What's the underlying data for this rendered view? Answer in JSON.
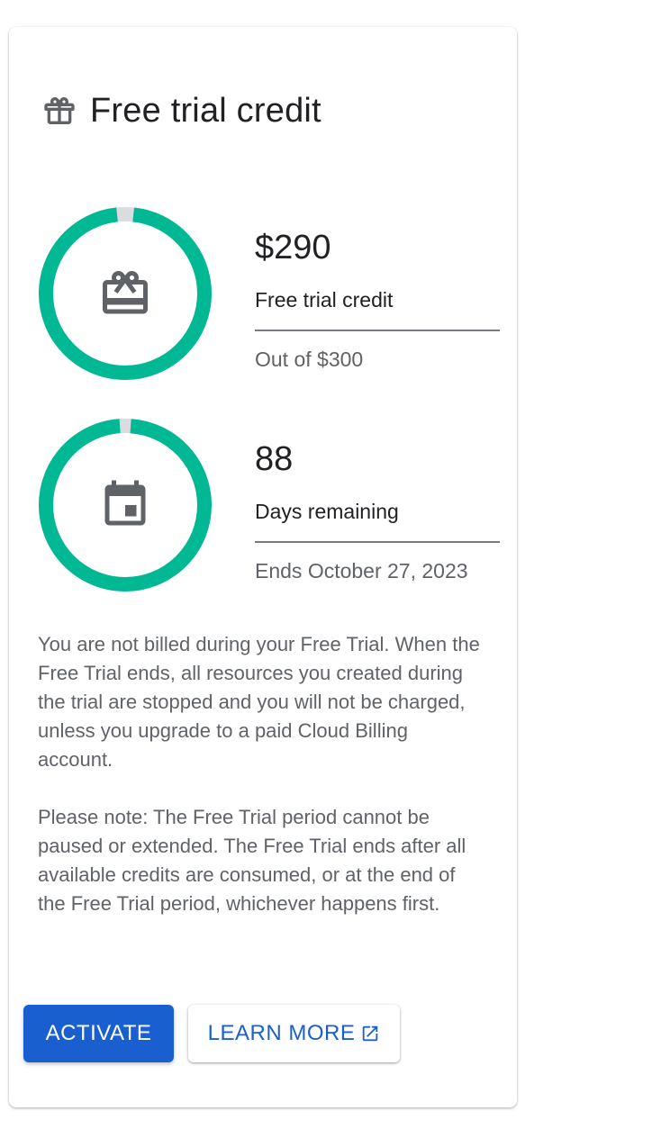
{
  "card": {
    "title": "Free trial credit",
    "title_icon": "gift-icon"
  },
  "colors": {
    "ring_fill": "#00b894",
    "ring_track": "#dadce0",
    "primary": "#1a5fd0",
    "icon_gray": "#5f6368"
  },
  "credit": {
    "value": "$290",
    "label": "Free trial credit",
    "sub": "Out of $300",
    "fraction": 0.9667,
    "icon": "card-giftcard-icon"
  },
  "days": {
    "value": "88",
    "label": "Days remaining",
    "sub": "Ends October 27, 2023",
    "fraction": 0.9778,
    "icon": "calendar-icon"
  },
  "paragraphs": {
    "p1": "You are not billed during your Free Trial. When the Free Trial ends, all resources you created during the trial are stopped and you will not be charged, unless you upgrade to a paid Cloud Billing account.",
    "p2": "Please note: The Free Trial period cannot be paused or extended. The Free Trial ends after all available credits are consumed, or at the end of the Free Trial period, whichever happens first."
  },
  "buttons": {
    "activate": "ACTIVATE",
    "learn_more": "LEARN MORE",
    "learn_more_icon": "open-in-new-icon"
  }
}
